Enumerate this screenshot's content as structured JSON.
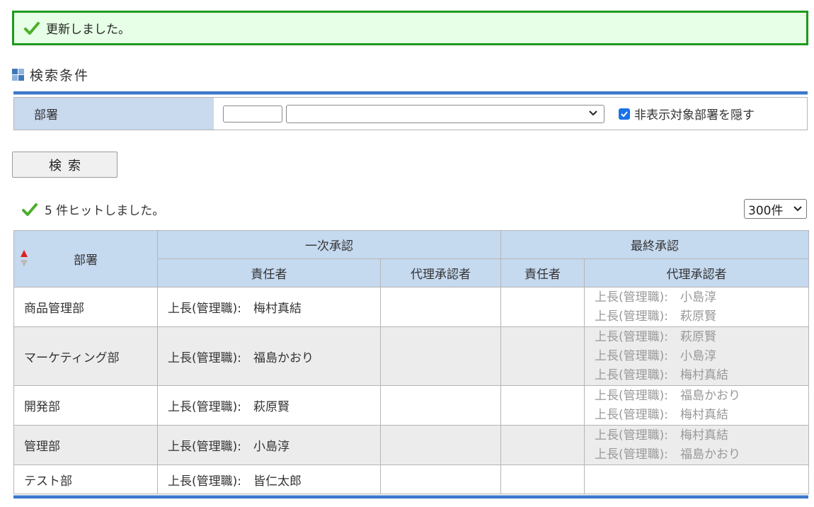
{
  "banner": {
    "message": "更新しました。",
    "icon": "checkmark-icon",
    "color": "#1e9a1e"
  },
  "search_section": {
    "title": "検索条件",
    "department_label": "部署",
    "code_value": "",
    "select_value": "",
    "hide_checkbox_label": "非表示対象部署を隠す",
    "hide_checkbox_checked": true,
    "search_button": "検索"
  },
  "results": {
    "hit_text": "5 件ヒットしました。",
    "per_page": "300件"
  },
  "table": {
    "headers": {
      "department": "部署",
      "first_approval": "一次承認",
      "final_approval": "最終承認",
      "responsible": "責任者",
      "proxy": "代理承認者",
      "final_responsible": "責任者",
      "final_proxy": "代理承認者"
    },
    "rows": [
      {
        "department": "商品管理部",
        "first_responsible": "上長(管理職):　梅村真結",
        "first_proxy": "",
        "final_responsible": "",
        "final_proxy": [
          "上長(管理職):　小島淳",
          "上長(管理職):　萩原賢"
        ]
      },
      {
        "department": "マーケティング部",
        "first_responsible": "上長(管理職):　福島かおり",
        "first_proxy": "",
        "final_responsible": "",
        "final_proxy": [
          "上長(管理職):　萩原賢",
          "上長(管理職):　小島淳",
          "上長(管理職):　梅村真結"
        ]
      },
      {
        "department": "開発部",
        "first_responsible": "上長(管理職):　萩原賢",
        "first_proxy": "",
        "final_responsible": "",
        "final_proxy": [
          "上長(管理職):　福島かおり",
          "上長(管理職):　梅村真結"
        ]
      },
      {
        "department": "管理部",
        "first_responsible": "上長(管理職):　小島淳",
        "first_proxy": "",
        "final_responsible": "",
        "final_proxy": [
          "上長(管理職):　梅村真結",
          "上長(管理職):　福島かおり"
        ]
      },
      {
        "department": "テスト部",
        "first_responsible": "上長(管理職):　皆仁太郎",
        "first_proxy": "",
        "final_responsible": "",
        "final_proxy": []
      }
    ]
  }
}
